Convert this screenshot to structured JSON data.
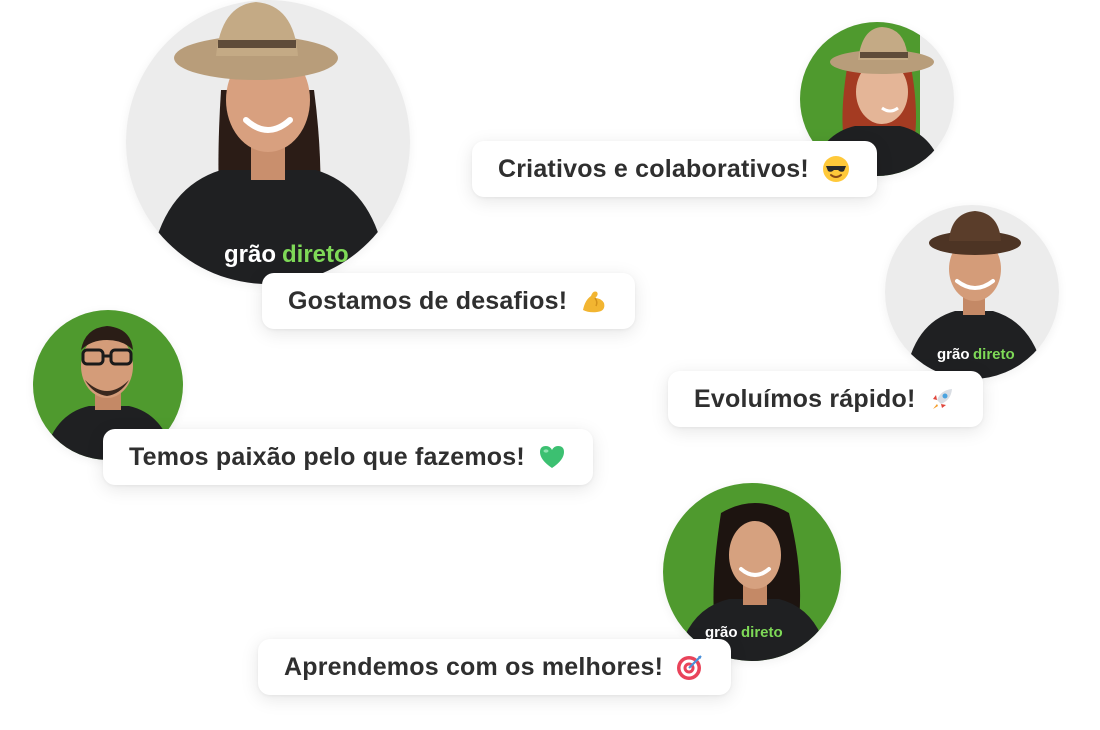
{
  "badges": [
    {
      "text": "Criativos e colaborativos!",
      "icon": "sunglasses-face-icon"
    },
    {
      "text": "Gostamos de desafios!",
      "icon": "flexed-biceps-icon"
    },
    {
      "text": "Evoluímos rápido!",
      "icon": "rocket-icon"
    },
    {
      "text": "Temos paixão pelo que fazemos!",
      "icon": "green-heart-icon"
    },
    {
      "text": "Aprendemos com os melhores!",
      "icon": "bullseye-icon"
    }
  ],
  "shirt_brand": {
    "part1": "grão",
    "part2": "direto"
  },
  "colors": {
    "brand_green": "#7ed957",
    "photo_green": "#4f9a2e",
    "shirt": "#1f2022",
    "text": "#2f2f2f"
  }
}
